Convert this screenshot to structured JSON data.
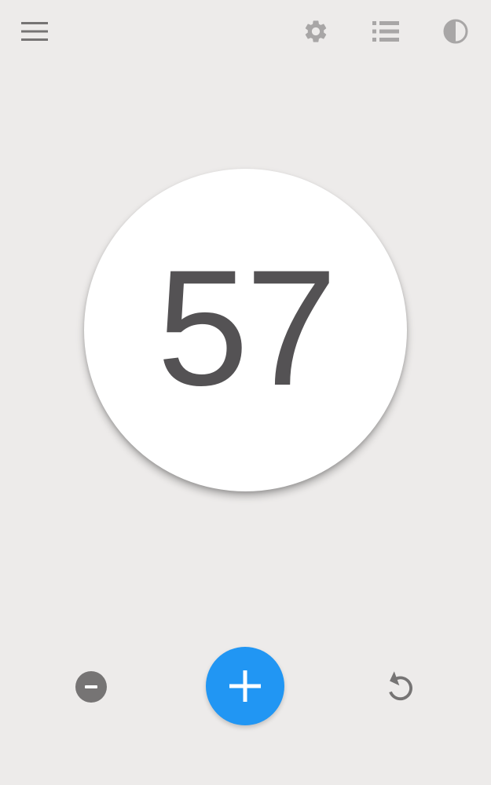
{
  "toolbar": {
    "menu_icon": "menu-icon",
    "settings_icon": "gear-icon",
    "list_icon": "list-icon",
    "theme_icon": "contrast-icon"
  },
  "counter": {
    "value": "57"
  },
  "controls": {
    "decrement_icon": "minus-circle-icon",
    "increment_icon": "plus-icon",
    "reset_icon": "refresh-icon"
  },
  "colors": {
    "background": "#edebea",
    "accent": "#2196f3",
    "icon_gray": "#767474",
    "number": "#545254"
  }
}
